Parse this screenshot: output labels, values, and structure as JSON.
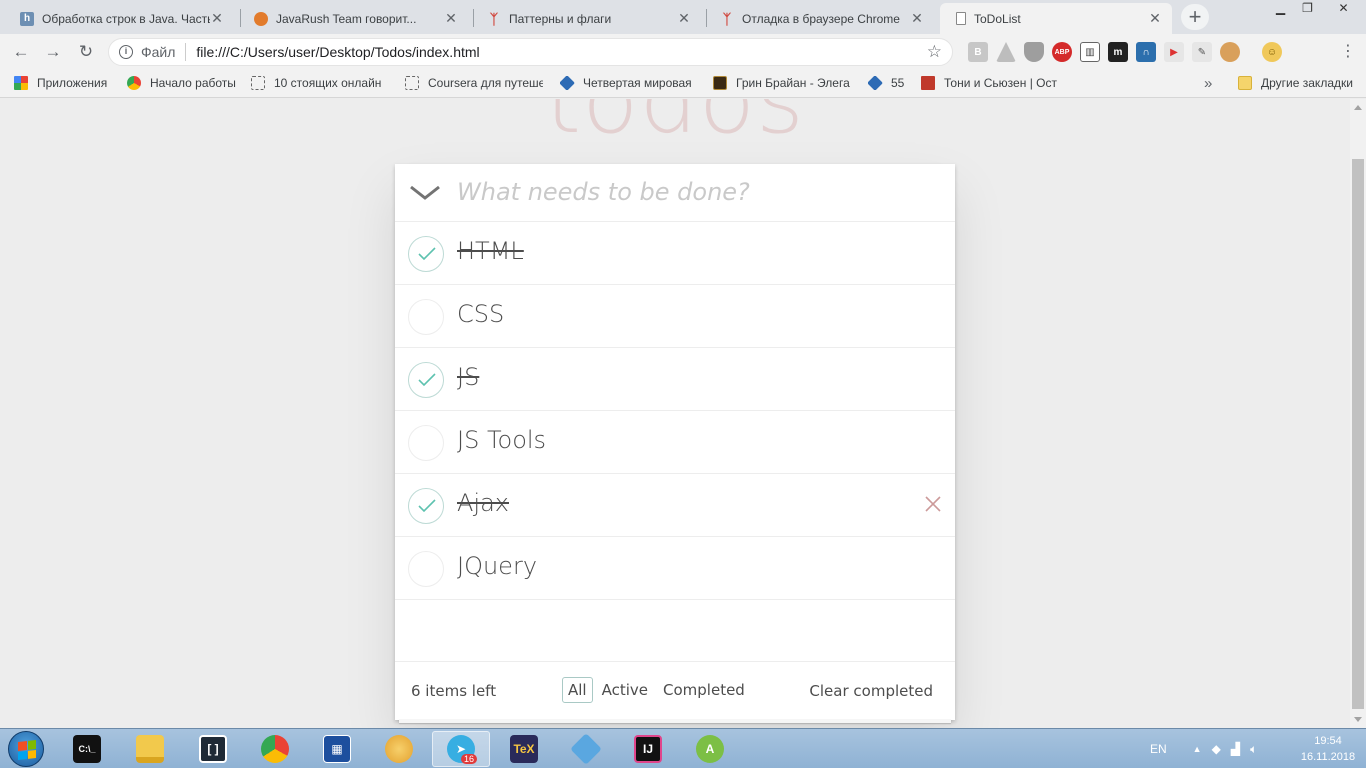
{
  "tabs": [
    {
      "title": "Обработка строк в Java. Часть",
      "favicon": "h",
      "color": "#6d8fb3"
    },
    {
      "title": "JavaRush Team говорит...",
      "favicon": "",
      "color": "#e27b2c"
    },
    {
      "title": "Паттерны и флаги",
      "favicon": "",
      "color": "#d14b42"
    },
    {
      "title": "Отладка в браузере Chrome",
      "favicon": "",
      "color": "#d14b42"
    },
    {
      "title": "ToDoList",
      "favicon": "",
      "color": "#ffffff"
    }
  ],
  "toolbar": {
    "scheme": "Файл",
    "url": "file:///C:/Users/user/Desktop/Todos/index.html"
  },
  "bookmarks": [
    {
      "label": "Приложения"
    },
    {
      "label": "Начало работы"
    },
    {
      "label": "10 стоящих онлайн"
    },
    {
      "label": "Coursera для путеше"
    },
    {
      "label": "Четвертая мировая"
    },
    {
      "label": "Грин Брайан - Элега"
    },
    {
      "label": "55"
    },
    {
      "label": "Тони и Сьюзен | Ост"
    }
  ],
  "bookmarks_other": "Другие закладки",
  "app": {
    "title": "todos",
    "placeholder": "What needs to be done?",
    "todos": [
      {
        "label": "HTML",
        "completed": true
      },
      {
        "label": "CSS",
        "completed": false
      },
      {
        "label": "JS",
        "completed": true
      },
      {
        "label": "JS Tools",
        "completed": false
      },
      {
        "label": "Ajax",
        "completed": true
      },
      {
        "label": "JQuery",
        "completed": false
      }
    ],
    "footer": {
      "count": "6 items left",
      "filters": [
        "All",
        "Active",
        "Completed"
      ],
      "selected_filter": "All",
      "clear": "Clear completed"
    }
  },
  "taskbar": {
    "lang": "EN",
    "time": "19:54",
    "date": "16.11.2018",
    "telegram_badge": "16"
  },
  "colors": {
    "check": "#5dc2af",
    "destroy": "#cc9a9a",
    "title": "#af2f2f"
  }
}
